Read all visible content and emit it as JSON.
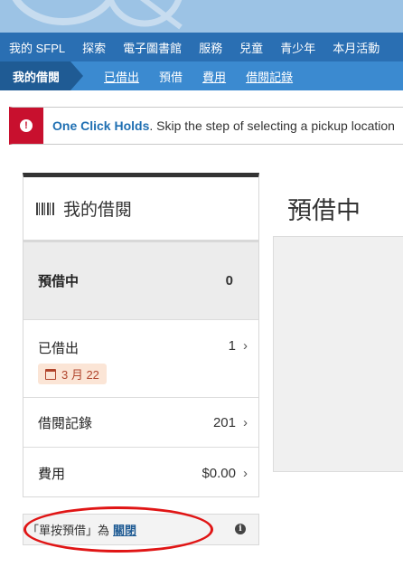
{
  "top_nav": [
    "我的 SFPL",
    "探索",
    "電子圖書館",
    "服務",
    "兒童",
    "青少年",
    "本月活動"
  ],
  "sub_nav": {
    "current": "我的借閱",
    "links": [
      "已借出",
      "預借",
      "費用",
      "借閱記錄"
    ]
  },
  "alert": {
    "strong": "One Click Holds",
    "text": ". Skip the step of selecting a pickup location"
  },
  "panel": {
    "title": "我的借閱",
    "rows": [
      {
        "label": "預借中",
        "count": "0"
      },
      {
        "label": "已借出",
        "count": "1",
        "due": "3 月 22"
      },
      {
        "label": "借閱記錄",
        "count": "201"
      },
      {
        "label": "費用",
        "count": "$0.00"
      }
    ]
  },
  "one_click": {
    "prefix": "「單按預借」為",
    "link": "關閉"
  },
  "main": {
    "title": "預借中"
  }
}
